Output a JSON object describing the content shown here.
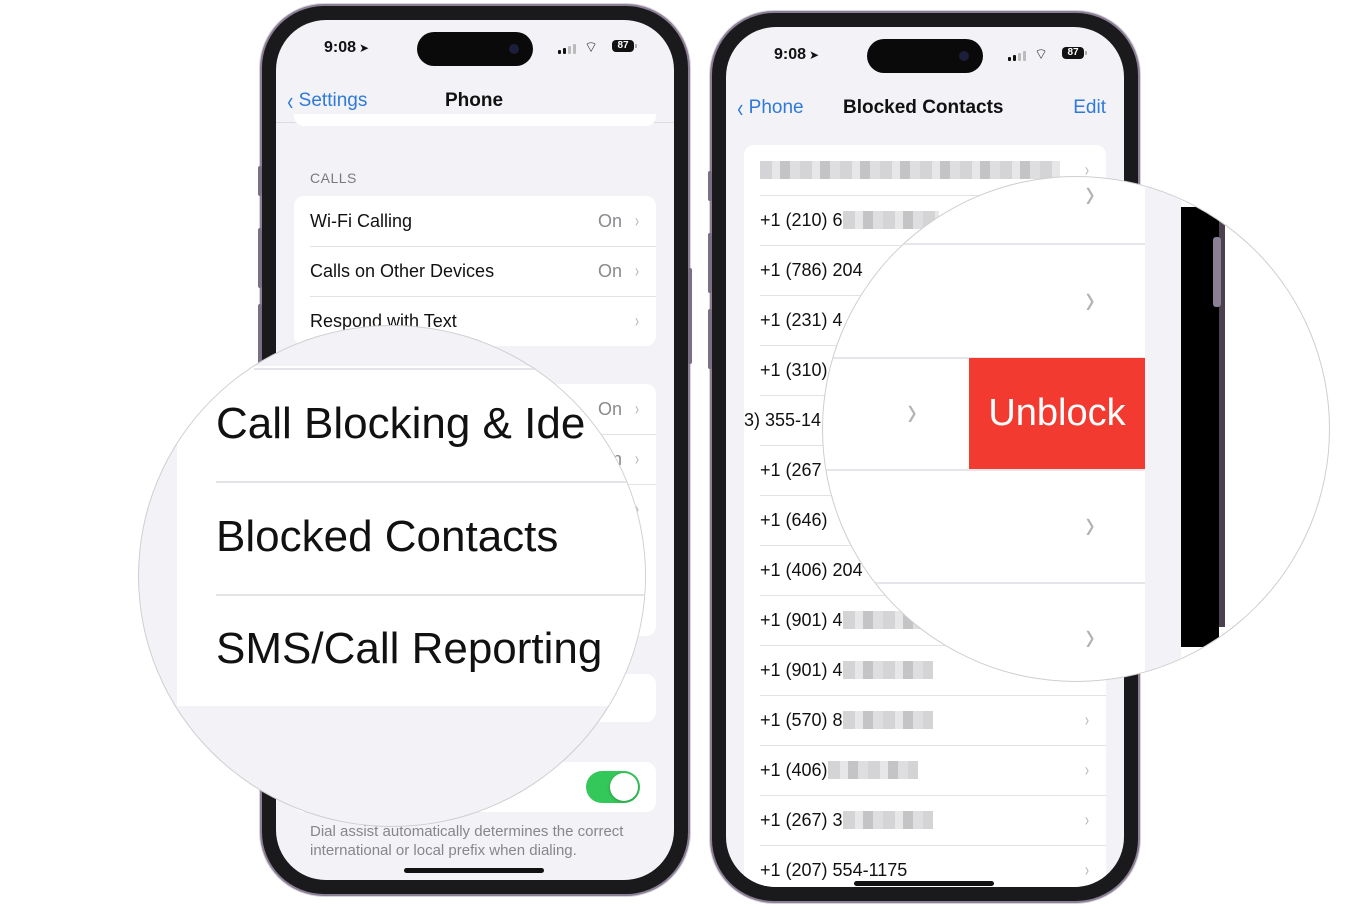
{
  "status_bar": {
    "time": "9:08",
    "location_icon": "location-arrow-icon",
    "battery": "87"
  },
  "left_phone": {
    "nav": {
      "back_label": "Settings",
      "title": "Phone"
    },
    "calls_section_label": "CALLS",
    "calls_rows": [
      {
        "label": "Wi-Fi Calling",
        "value": "On"
      },
      {
        "label": "Calls on Other Devices",
        "value": "On"
      },
      {
        "label": "Respond with Text",
        "value": ""
      }
    ],
    "second_group_visible_values": [
      "On",
      "On"
    ],
    "dial_assist": {
      "toggle_on": true,
      "note": "Dial assist automatically determines the correct international or local prefix when dialing."
    }
  },
  "left_magnifier": {
    "rows": [
      "Call Blocking & Identification",
      "Blocked Contacts",
      "SMS/Call Reporting"
    ],
    "visible_first_row": "Call Blocking & Ide"
  },
  "right_phone": {
    "nav": {
      "back_label": "Phone",
      "title": "Blocked Contacts",
      "action_label": "Edit"
    },
    "contacts": [
      {
        "number": "",
        "redacted": true
      },
      {
        "number": "+1 (210) 6",
        "redacted": true
      },
      {
        "number": "+1 (786) 204",
        "redacted": false
      },
      {
        "number": "+1 (231) 4",
        "redacted": false
      },
      {
        "number": "+1 (310)",
        "redacted": false
      },
      {
        "number": "3) 355-14",
        "redacted": false,
        "swiped": true
      },
      {
        "number": "+1 (267",
        "redacted": false
      },
      {
        "number": "+1 (646)",
        "redacted": false
      },
      {
        "number": "+1 (406) 204",
        "redacted": false
      },
      {
        "number": "+1 (901) 4",
        "redacted": true
      },
      {
        "number": "+1 (901) 4",
        "redacted": true
      },
      {
        "number": "+1 (570) 8",
        "redacted": true
      },
      {
        "number": "+1 (406)",
        "redacted": true
      },
      {
        "number": "+1 (267) 3",
        "redacted": true
      },
      {
        "number": "+1 (207) 554-1175",
        "redacted": true
      }
    ]
  },
  "right_magnifier": {
    "unblock_label": "Unblock",
    "unblock_color": "#f33a30"
  },
  "colors": {
    "accent_blue": "#2f7ad9",
    "toggle_green": "#34c759",
    "grouped_background": "#f2f2f7"
  }
}
